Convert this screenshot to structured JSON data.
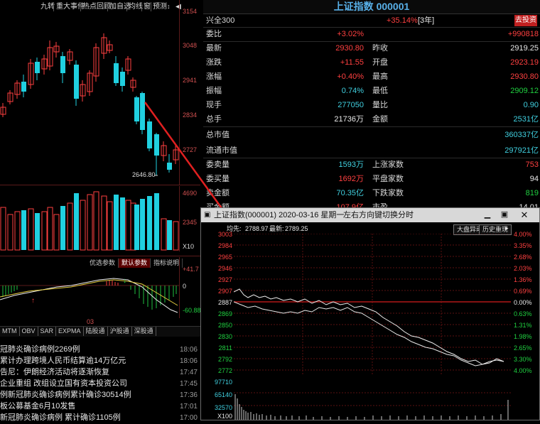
{
  "left_toolbar": {
    "items": [
      "九转",
      "重大事件",
      "热点回顾",
      "加自选",
      "均线",
      "窗",
      "预测"
    ]
  },
  "kline": {
    "price_axis": [
      "3154",
      "3048",
      "2941",
      "2834",
      "2727"
    ],
    "low_marker": "2646.80",
    "volume_axis": [
      "4690",
      "2345",
      "X10"
    ],
    "indicator_axis": [
      "+41.7",
      "0",
      "-60.88"
    ],
    "indicator_tabs": [
      "优选参数",
      "默认参数",
      "指标说明"
    ],
    "indicator_active": 1,
    "date_label": "03",
    "bottom_tabs": [
      "MTM",
      "OBV",
      "SAR",
      "EXPMA",
      "陆股通",
      "沪股通",
      "深股通"
    ]
  },
  "news": [
    {
      "text": "冠肺炎确诊病例2269例",
      "time": "18:06"
    },
    {
      "text": "累计办理跨境人民币结算逾14万亿元",
      "time": "18:06"
    },
    {
      "text": "告尼：伊朗经济活动将逐渐恢复",
      "time": "17:47"
    },
    {
      "text": "企业重组 改组设立国有资本投资公司",
      "time": "17:45"
    },
    {
      "text": "例新冠肺炎确诊病例累计确诊30514例",
      "time": "17:36"
    },
    {
      "text": "板公募基金6月10发售",
      "time": "17:01"
    },
    {
      "text": "新冠肺炎确诊病例 累计确诊1105例",
      "time": "17:00"
    }
  ],
  "quote": {
    "title": "上证指数 000001",
    "sub_left": "兴全300",
    "sub_right": "+35.14%",
    "sub_tag": "[3年]",
    "go_button": "去投资",
    "weibi_label": "委比",
    "weibi_value": "+3.02%",
    "weicha_value": "+990818",
    "rows": [
      {
        "l1": "最新",
        "v1": "2930.80",
        "c1": "red",
        "l2": "昨收",
        "v2": "2919.25",
        "c2": "white"
      },
      {
        "l1": "涨跌",
        "v1": "+11.55",
        "c1": "red",
        "l2": "开盘",
        "v2": "2923.19",
        "c2": "red"
      },
      {
        "l1": "涨幅",
        "v1": "+0.40%",
        "c1": "red",
        "l2": "最高",
        "v2": "2930.80",
        "c2": "red"
      },
      {
        "l1": "振幅",
        "v1": "0.74%",
        "c1": "cyan",
        "l2": "最低",
        "v2": "2909.12",
        "c2": "green"
      },
      {
        "l1": "现手",
        "v1": "277050",
        "c1": "cyan",
        "l2": "量比",
        "v2": "0.90",
        "c2": "cyan"
      },
      {
        "l1": "总手",
        "v1": "21736万",
        "c1": "white",
        "l2": "金额",
        "v2": "2531亿",
        "c2": "cyan"
      }
    ],
    "mcap_rows": [
      {
        "label": "总市值",
        "value": "360337亿"
      },
      {
        "label": "流通市值",
        "value": "297921亿"
      }
    ],
    "order_rows": [
      {
        "l1": "委卖量",
        "v1": "1593万",
        "c1": "cyan",
        "l2": "上涨家数",
        "v2": "753",
        "c2": "red"
      },
      {
        "l1": "委买量",
        "v1": "1692万",
        "c1": "red",
        "l2": "平盘家数",
        "v2": "94",
        "c2": "white"
      },
      {
        "l1": "卖金额",
        "v1": "70.35亿",
        "c1": "cyan",
        "l2": "下跌家数",
        "v2": "819",
        "c2": "green"
      },
      {
        "l1": "买金额",
        "v1": "107.9亿",
        "c1": "red",
        "l2": "市盈",
        "v2": "14.01",
        "c2": "white"
      }
    ]
  },
  "popup": {
    "title": "上证指数(000001) 2020-03-16 星期一",
    "hint": "左右方向键切换分时",
    "header_prefix": "均先:",
    "avg_value": "2788.97",
    "last_label": "最新:",
    "last_value": "2789.25",
    "btn_abnormal": "大盘异动",
    "btn_history": "历史重现",
    "y_left": [
      "3003",
      "2984",
      "2965",
      "2946",
      "2927",
      "2907",
      "2887",
      "2869",
      "2850",
      "2830",
      "2811",
      "2792",
      "2772"
    ],
    "y_right": [
      "4.00%",
      "3.35%",
      "2.68%",
      "2.03%",
      "1.36%",
      "0.69%",
      "0.00%",
      "0.63%",
      "1.31%",
      "1.98%",
      "2.65%",
      "3.30%",
      "4.00%"
    ],
    "vol_axis": [
      "97710",
      "65140",
      "32570",
      "X100"
    ]
  },
  "colors": {
    "up": "#ff4040",
    "down": "#20d0e0",
    "title": "#58b0e8",
    "grid": "#8a1a1a"
  }
}
